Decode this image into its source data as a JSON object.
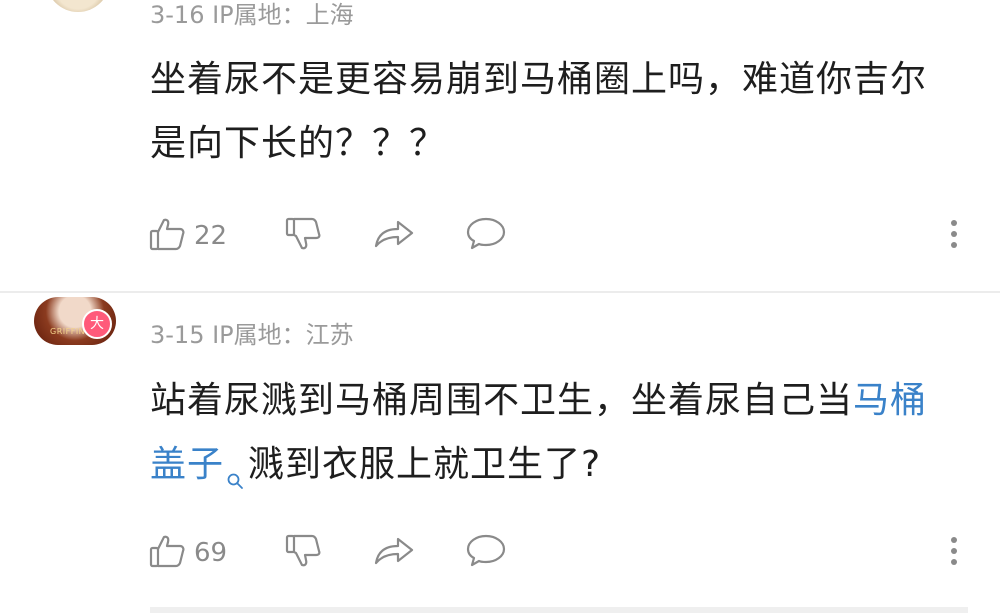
{
  "comments": [
    {
      "meta": "3-16  IP属地：上海",
      "text_parts": {
        "a": "坐着尿不是更容易崩到马桶圈上吗，难道你吉尔是向下长的？？？"
      },
      "likes": "22"
    },
    {
      "meta": "3-15  IP属地：江苏",
      "text_parts": {
        "a": "站着尿溅到马桶周围不卫生，坐着尿自己当",
        "link": "马桶盖子",
        "b": "溅到衣服上就卫生了?"
      },
      "likes": "69",
      "badge": "大",
      "avatar_text": "GRIFFIN"
    }
  ],
  "icons": {
    "like": "thumbs-up-icon",
    "dislike": "thumbs-down-icon",
    "share": "share-arrow-icon",
    "reply": "chat-bubble-icon",
    "more": "more-vertical-icon",
    "link_search": "search-icon"
  },
  "colors": {
    "link": "#3a82c9",
    "meta": "#9a9a9a",
    "badge": "#ff5a7a"
  }
}
